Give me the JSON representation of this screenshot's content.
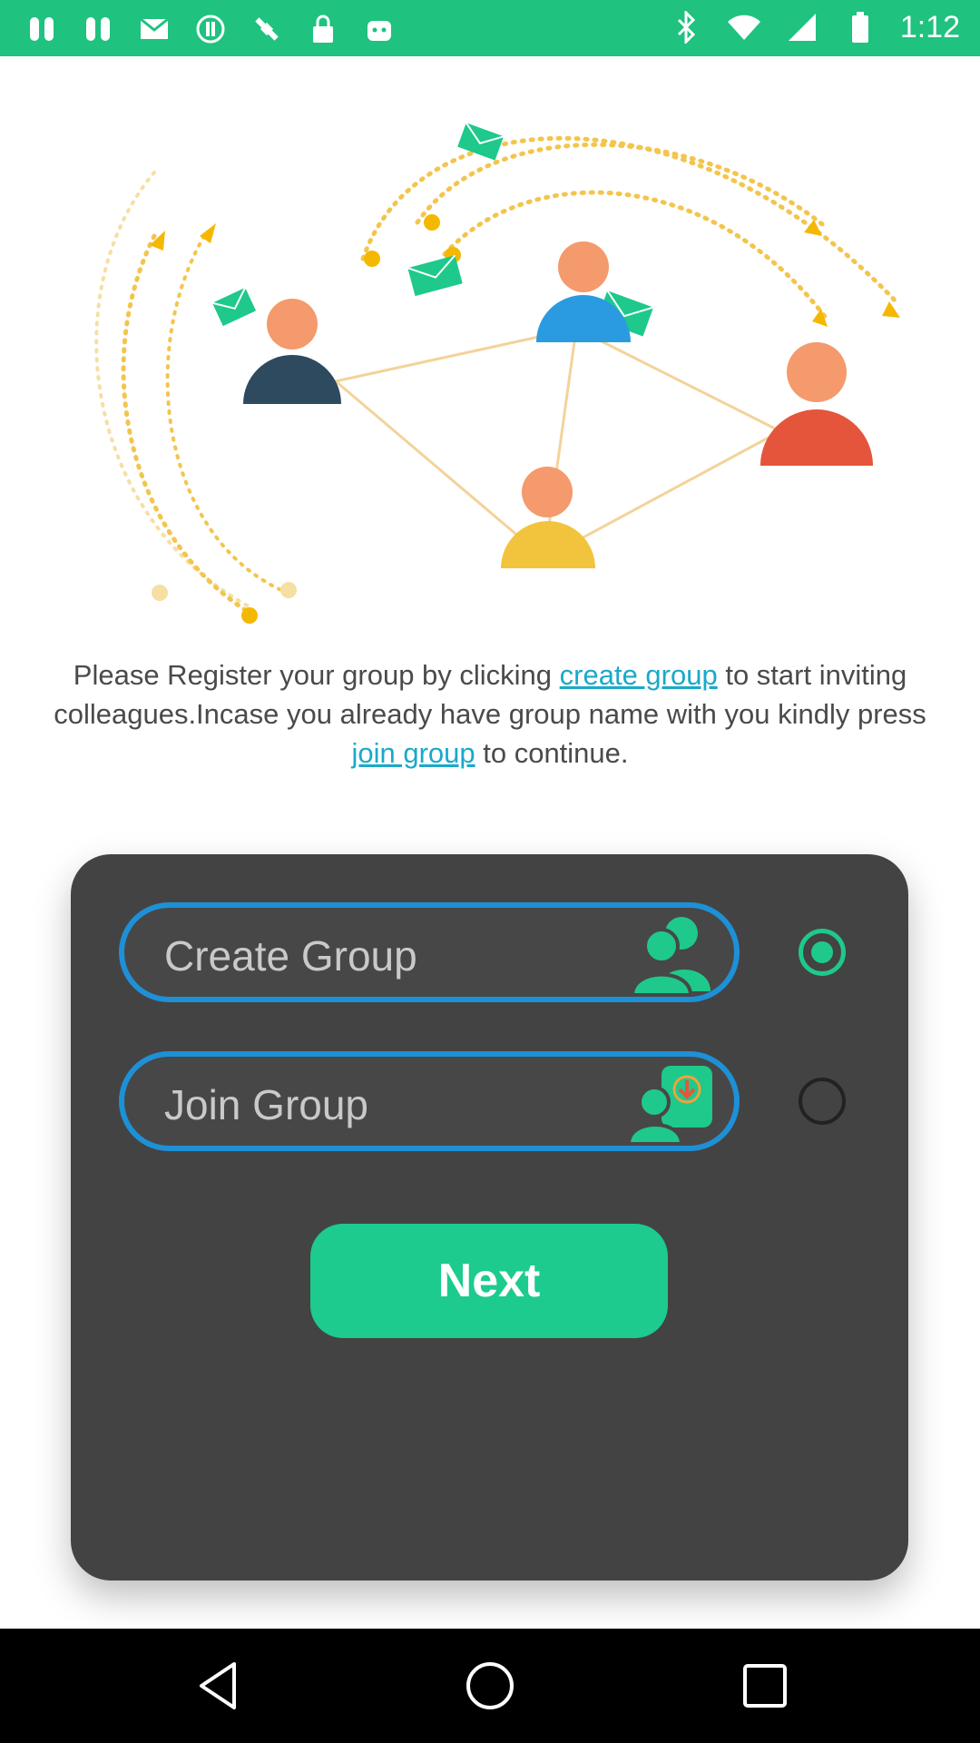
{
  "status_bar": {
    "time": "1:12",
    "icons": [
      "slack-icon",
      "slack-icon",
      "gmail-icon",
      "p-icon",
      "satellite-icon",
      "lock-icon",
      "android-icon",
      "bluetooth-icon",
      "wifi-icon",
      "signal-icon",
      "battery-icon"
    ]
  },
  "description": {
    "part1": "Please Register your group by clicking ",
    "link1": "create group",
    "part2": " to start inviting colleagues.Incase you already have group name with you kindly press ",
    "link2": "join group",
    "part3": " to continue."
  },
  "options": {
    "create_label": "Create Group",
    "join_label": "Join Group",
    "selected": "create"
  },
  "next_button": "Next",
  "colors": {
    "accent": "#1dcb8e",
    "status_bar": "#1fc27f",
    "card": "#434343",
    "option_border": "#1e90d6",
    "link": "#1aa9c9"
  }
}
